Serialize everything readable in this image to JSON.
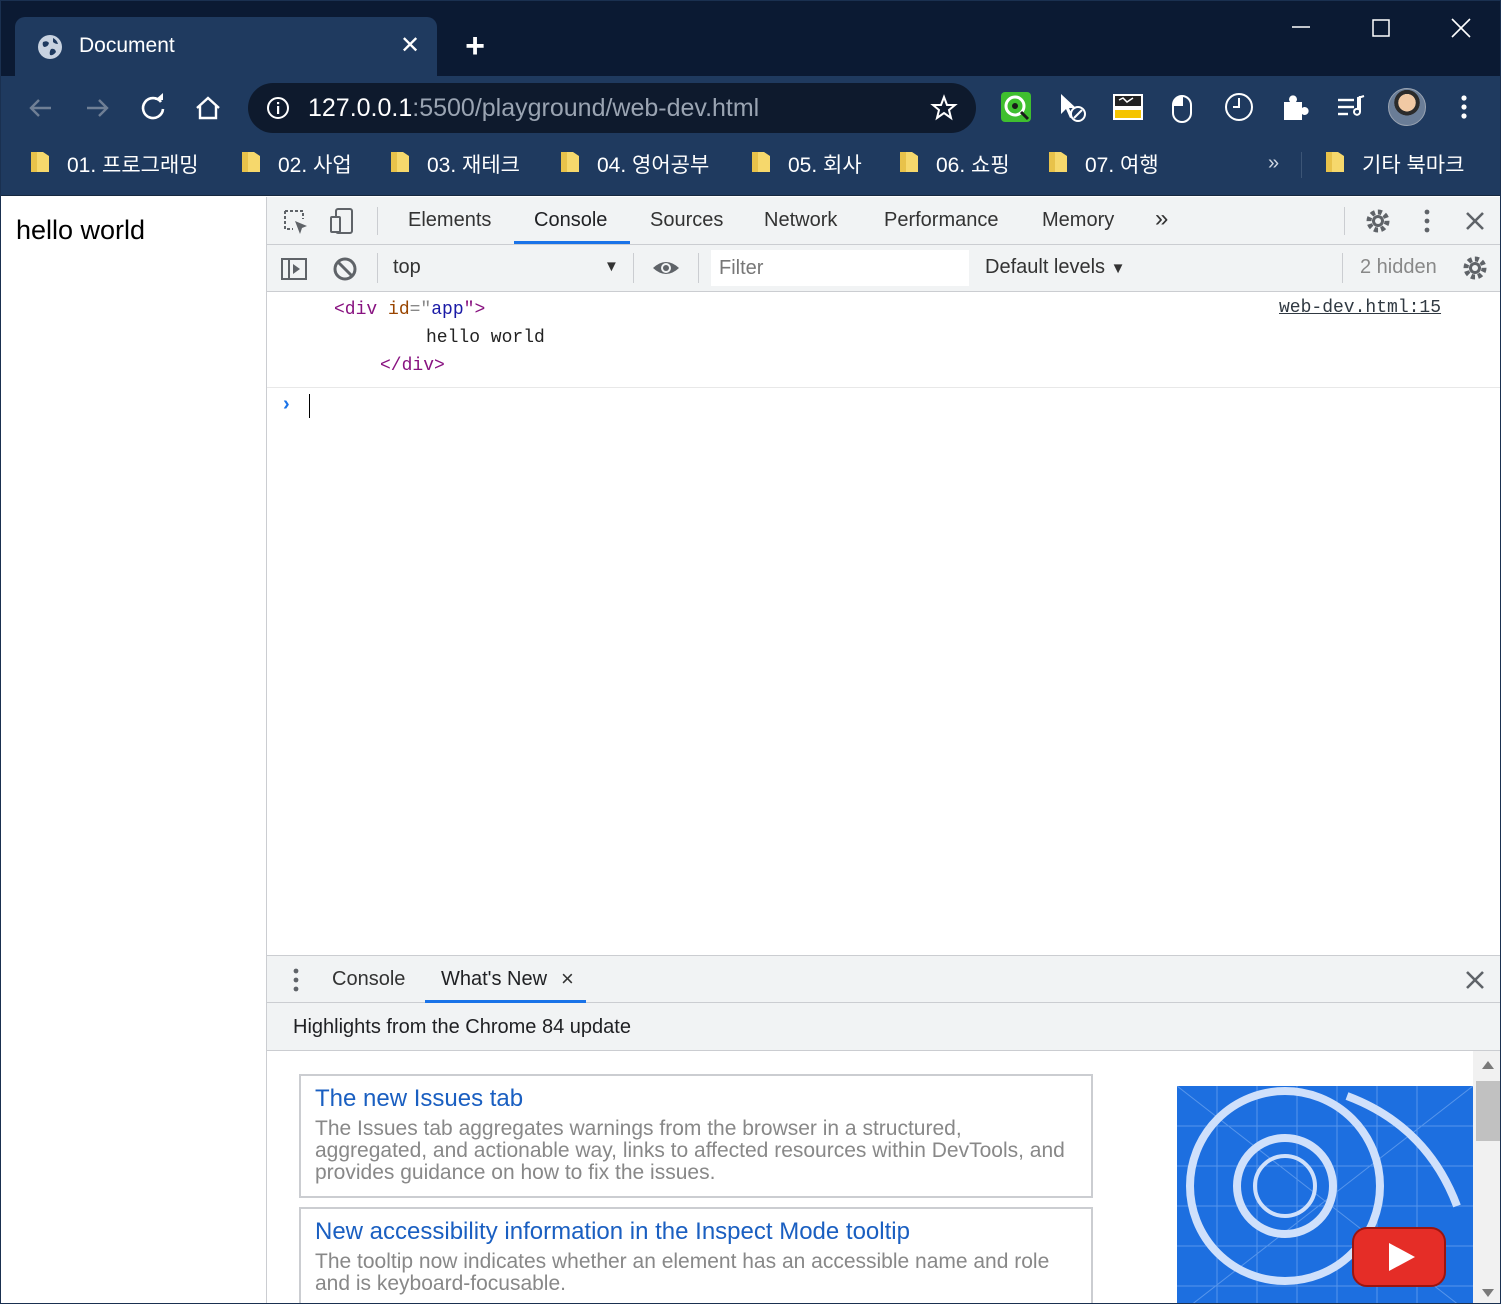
{
  "browser": {
    "tab_title": "Document",
    "url_host": "127.0.0.1",
    "url_rest": ":5500/playground/web-dev.html"
  },
  "bookmarks": [
    {
      "label": "01. 프로그래밍"
    },
    {
      "label": "02. 사업"
    },
    {
      "label": "03. 재테크"
    },
    {
      "label": "04. 영어공부"
    },
    {
      "label": "05. 회사"
    },
    {
      "label": "06. 쇼핑"
    },
    {
      "label": "07. 여행"
    }
  ],
  "bookmarks_more": "»",
  "bookmarks_other": "기타 북마크",
  "page": {
    "text": "hello world"
  },
  "devtools": {
    "tabs": [
      "Elements",
      "Console",
      "Sources",
      "Network",
      "Performance",
      "Memory"
    ],
    "overflow": "»",
    "context": "top",
    "filter_placeholder": "Filter",
    "levels": "Default levels",
    "hidden": "2 hidden",
    "message": {
      "line1_open": "<div ",
      "line1_attr": "id",
      "line1_eq": "=\"",
      "line1_val": "app",
      "line1_close": "\">",
      "line2": "hello world",
      "line3": "</div>",
      "source": "web-dev.html:15"
    },
    "prompt": "›"
  },
  "drawer": {
    "tabs": [
      "Console",
      "What's New"
    ],
    "close_tab": "×",
    "header": "Highlights from the Chrome 84 update",
    "cards": [
      {
        "title": "The new Issues tab",
        "body": "The Issues tab aggregates warnings from the browser in a structured, aggregated, and actionable way, links to affected resources within DevTools, and provides guidance on how to fix the issues."
      },
      {
        "title": "New accessibility information in the Inspect Mode tooltip",
        "body": "The tooltip now indicates whether an element has an accessible name and role and is keyboard-focusable."
      }
    ]
  },
  "colors": {
    "titlebar": "#0b1a33",
    "toolbar": "#1f3a5f",
    "accent": "#1a73e8",
    "link": "#1a5fc1"
  }
}
